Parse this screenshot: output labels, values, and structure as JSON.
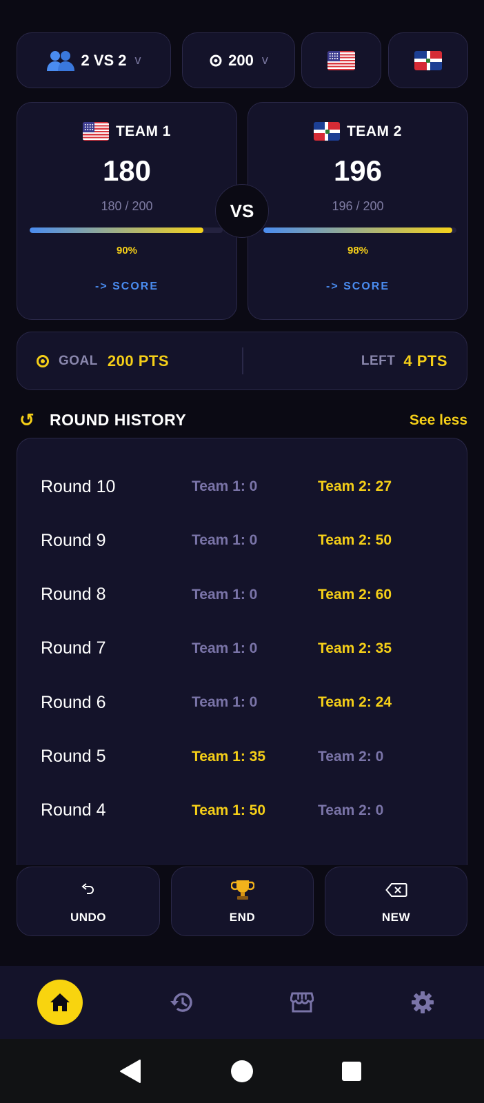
{
  "selectors": {
    "mode": "2 VS 2",
    "mode_chevron": "v",
    "goal_value": "200",
    "goal_chevron": "v",
    "flag_left": "us-flag",
    "flag_right": "dominican-republic-flag"
  },
  "teams": [
    {
      "name": "TEAM 1",
      "flag": "us-flag",
      "score": "180",
      "fraction": "180 / 200",
      "progress": 0.9,
      "percent": "90%",
      "link": "-> SCORE"
    },
    {
      "name": "TEAM 2",
      "flag": "dominican-republic-flag",
      "score": "196",
      "fraction": "196 / 200",
      "progress": 0.98,
      "percent": "98%",
      "link": "-> SCORE"
    }
  ],
  "vs_label": "VS",
  "goal": {
    "label": "GOAL",
    "value": "200 PTS",
    "left_label": "LEFT",
    "left_value": "4 PTS"
  },
  "round_history": {
    "title": "ROUND HISTORY",
    "toggle": "See less",
    "rows": [
      {
        "round": "Round 10",
        "team1": "Team 1: 0",
        "team2": "Team 2: 27",
        "winner": 2
      },
      {
        "round": "Round 9",
        "team1": "Team 1: 0",
        "team2": "Team 2: 50",
        "winner": 2
      },
      {
        "round": "Round 8",
        "team1": "Team 1: 0",
        "team2": "Team 2: 60",
        "winner": 2
      },
      {
        "round": "Round 7",
        "team1": "Team 1: 0",
        "team2": "Team 2: 35",
        "winner": 2
      },
      {
        "round": "Round 6",
        "team1": "Team 1: 0",
        "team2": "Team 2: 24",
        "winner": 2
      },
      {
        "round": "Round 5",
        "team1": "Team 1: 35",
        "team2": "Team 2: 0",
        "winner": 1
      },
      {
        "round": "Round 4",
        "team1": "Team 1: 50",
        "team2": "Team 2: 0",
        "winner": 1
      }
    ]
  },
  "actions": {
    "undo": "UNDO",
    "end": "END",
    "new": "NEW"
  },
  "nav": {
    "items": [
      "home-icon",
      "history-icon",
      "store-icon",
      "settings-icon"
    ],
    "active": "home-icon"
  },
  "colors": {
    "accent": "#f5cf18",
    "link": "#4a8cf0",
    "background": "#0b0a14",
    "card": "#14132a",
    "muted": "#7a74a8"
  }
}
